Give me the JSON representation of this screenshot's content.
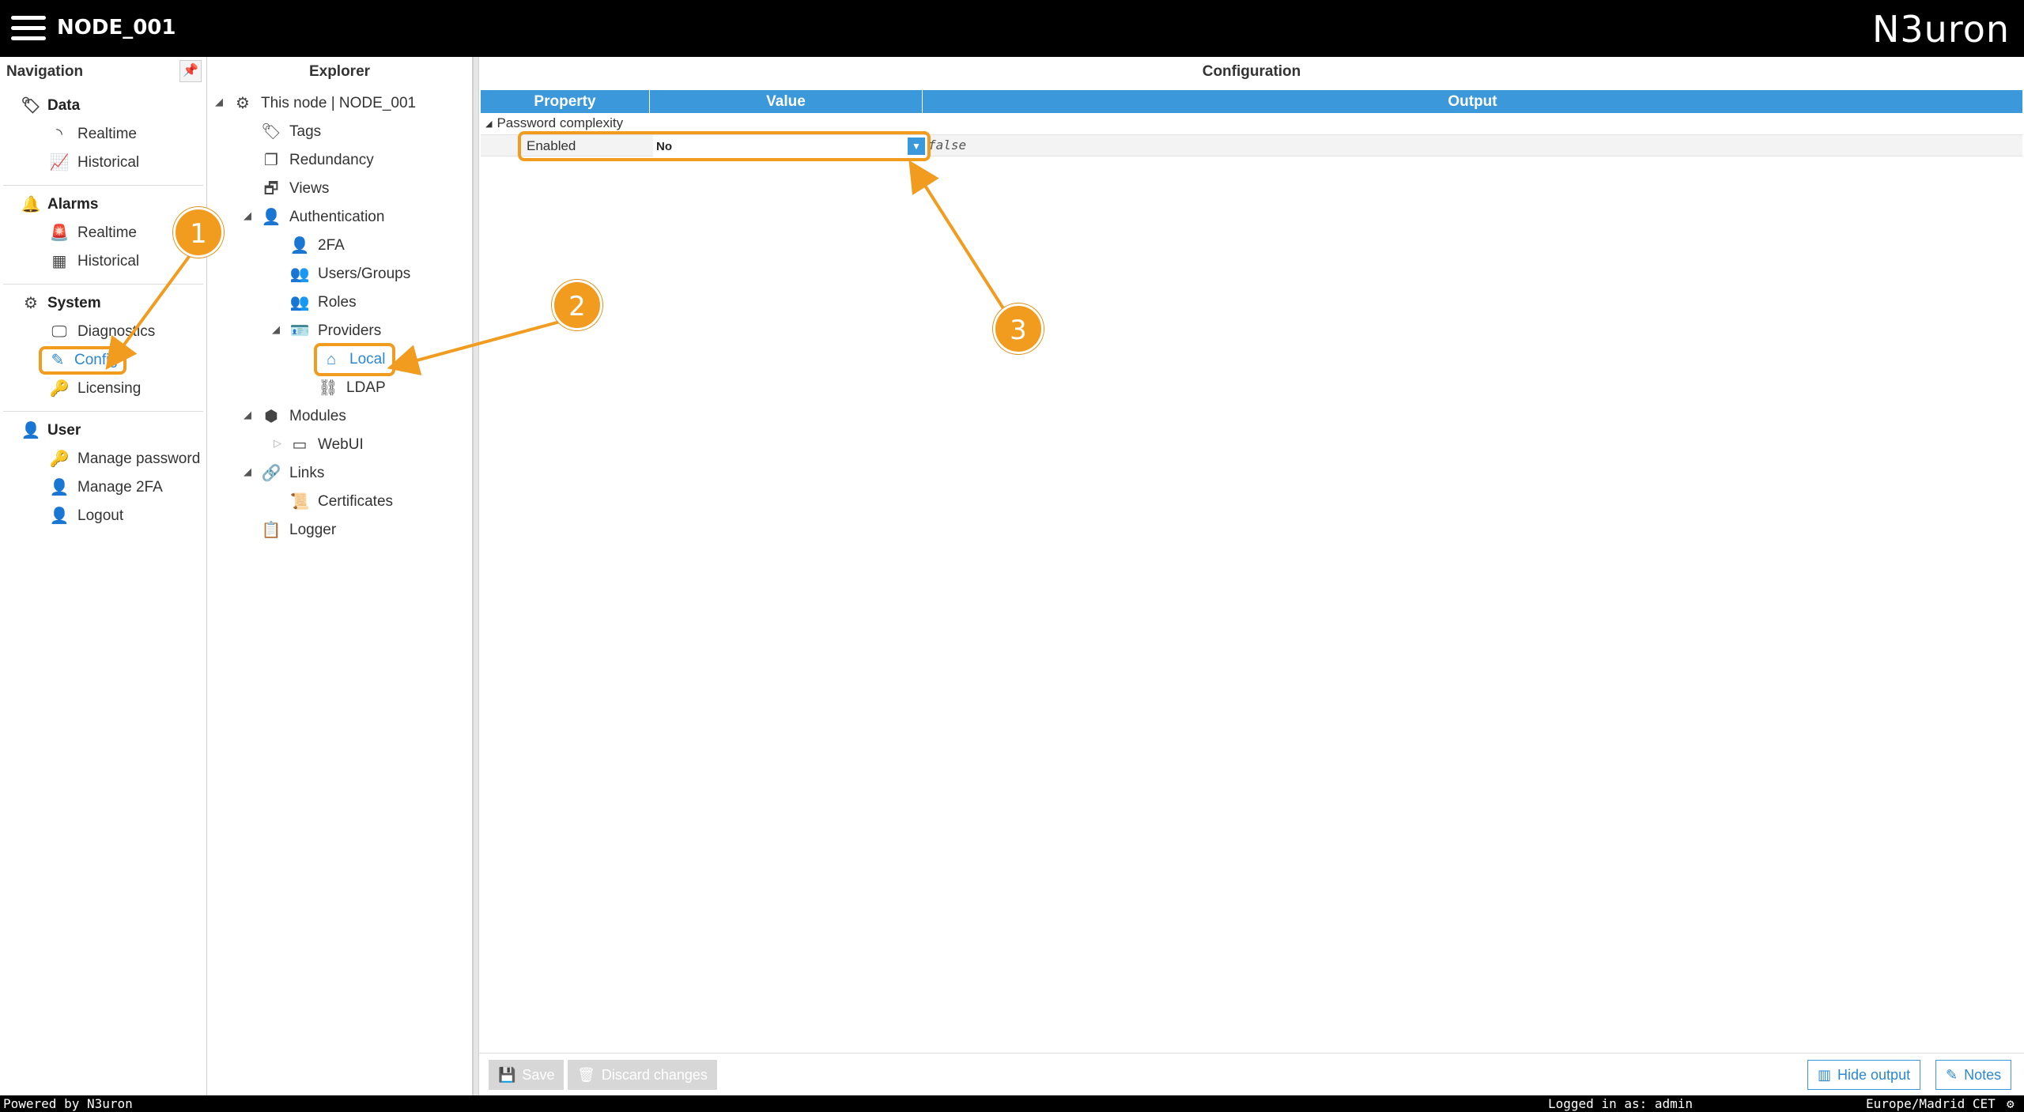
{
  "header": {
    "node": "NODE_001",
    "brand": "N3uron"
  },
  "navigation": {
    "title": "Navigation",
    "groups": [
      {
        "title": "Data",
        "items": [
          "Realtime",
          "Historical"
        ]
      },
      {
        "title": "Alarms",
        "items": [
          "Realtime",
          "Historical"
        ]
      },
      {
        "title": "System",
        "items": [
          "Diagnostics",
          "Config",
          "Licensing"
        ]
      },
      {
        "title": "User",
        "items": [
          "Manage password",
          "Manage 2FA",
          "Logout"
        ]
      }
    ]
  },
  "explorer": {
    "title": "Explorer",
    "root": "This node | NODE_001",
    "tags": "Tags",
    "redundancy": "Redundancy",
    "views": "Views",
    "authentication": "Authentication",
    "twofa": "2FA",
    "users_groups": "Users/Groups",
    "roles": "Roles",
    "providers": "Providers",
    "local": "Local",
    "ldap": "LDAP",
    "modules": "Modules",
    "webui": "WebUI",
    "links": "Links",
    "certificates": "Certificates",
    "logger": "Logger"
  },
  "configuration": {
    "title": "Configuration",
    "columns": [
      "Property",
      "Value",
      "Output"
    ],
    "category": "Password complexity",
    "property": "Enabled",
    "value": "No",
    "output": "false",
    "save": "Save",
    "discard": "Discard changes",
    "hide_output": "Hide output",
    "notes": "Notes"
  },
  "footer": {
    "powered": "Powered by N3uron",
    "logged": "Logged in as: admin",
    "timezone": "Europe/Madrid CET"
  },
  "callouts": [
    "1",
    "2",
    "3"
  ],
  "colors": {
    "accent": "#3b98da",
    "highlight": "#f29c1f",
    "bar": "#000000"
  }
}
